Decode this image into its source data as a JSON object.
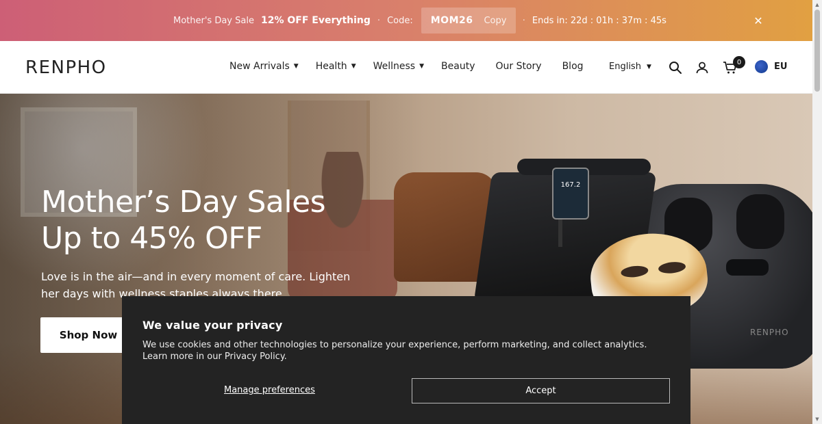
{
  "announcement": {
    "sale_label": "Mother's Day Sale",
    "offer": "12% OFF Everything",
    "separator": "·",
    "code_label": "Code:",
    "code": "MOM26",
    "copy_label": "Copy",
    "ends_text": "Ends in: 22d : 01h : 37m : 45s",
    "close_icon": "✕"
  },
  "header": {
    "logo": "RENPHO",
    "nav": [
      {
        "label": "New Arrivals",
        "has_dropdown": true
      },
      {
        "label": "Health",
        "has_dropdown": true
      },
      {
        "label": "Wellness",
        "has_dropdown": true
      },
      {
        "label": "Beauty",
        "has_dropdown": false
      },
      {
        "label": "Our Story",
        "has_dropdown": false
      },
      {
        "label": "Blog",
        "has_dropdown": false
      }
    ],
    "language": "English",
    "cart_count": "0",
    "region": "EU",
    "icons": [
      "search-icon",
      "account-icon",
      "cart-icon",
      "globe-icon"
    ]
  },
  "hero": {
    "title_line1": "Mother’s Day Sales",
    "title_line2": "Up to 45% OFF",
    "subtitle": "Love is in the air—and in every moment of care. Lighten her days with wellness staples always there.",
    "cta": "Shop Now",
    "scale_reading": "167.2",
    "product_brand": "RENPHO"
  },
  "cookie": {
    "title": "We value your privacy",
    "body": "We use cookies and other technologies to personalize your experience, perform marketing, and collect analytics. Learn more in our Privacy Policy.",
    "manage": "Manage preferences",
    "accept": "Accept"
  },
  "colors": {
    "announce_start": "#cd5f76",
    "announce_end": "#e1a042",
    "cookie_bg": "#232323"
  }
}
